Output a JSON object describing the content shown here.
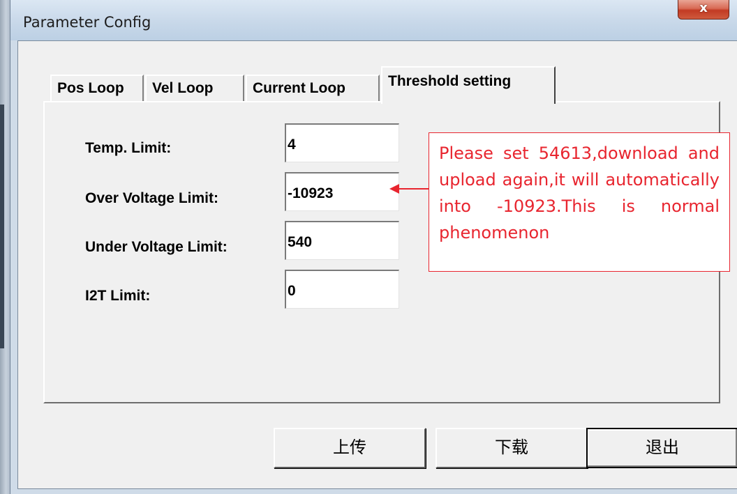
{
  "window": {
    "title": "Parameter Config",
    "close_label": "x"
  },
  "tabs": [
    {
      "label": "Pos Loop"
    },
    {
      "label": "Vel Loop"
    },
    {
      "label": "Current Loop"
    },
    {
      "label": "Threshold setting"
    }
  ],
  "fields": [
    {
      "label": "Temp. Limit:",
      "value": "4"
    },
    {
      "label": "Over  Voltage Limit:",
      "value": "-10923"
    },
    {
      "label": "Under Voltage Limit:",
      "value": "540"
    },
    {
      "label": "I2T Limit:",
      "value": "0"
    }
  ],
  "annotation": {
    "text": "Please set 54613,download and upload again,it will automatically into -10923.This is normal phenomenon",
    "color": "#e8252f"
  },
  "buttons": {
    "upload": "上传",
    "download": "下载",
    "exit": "退出"
  }
}
